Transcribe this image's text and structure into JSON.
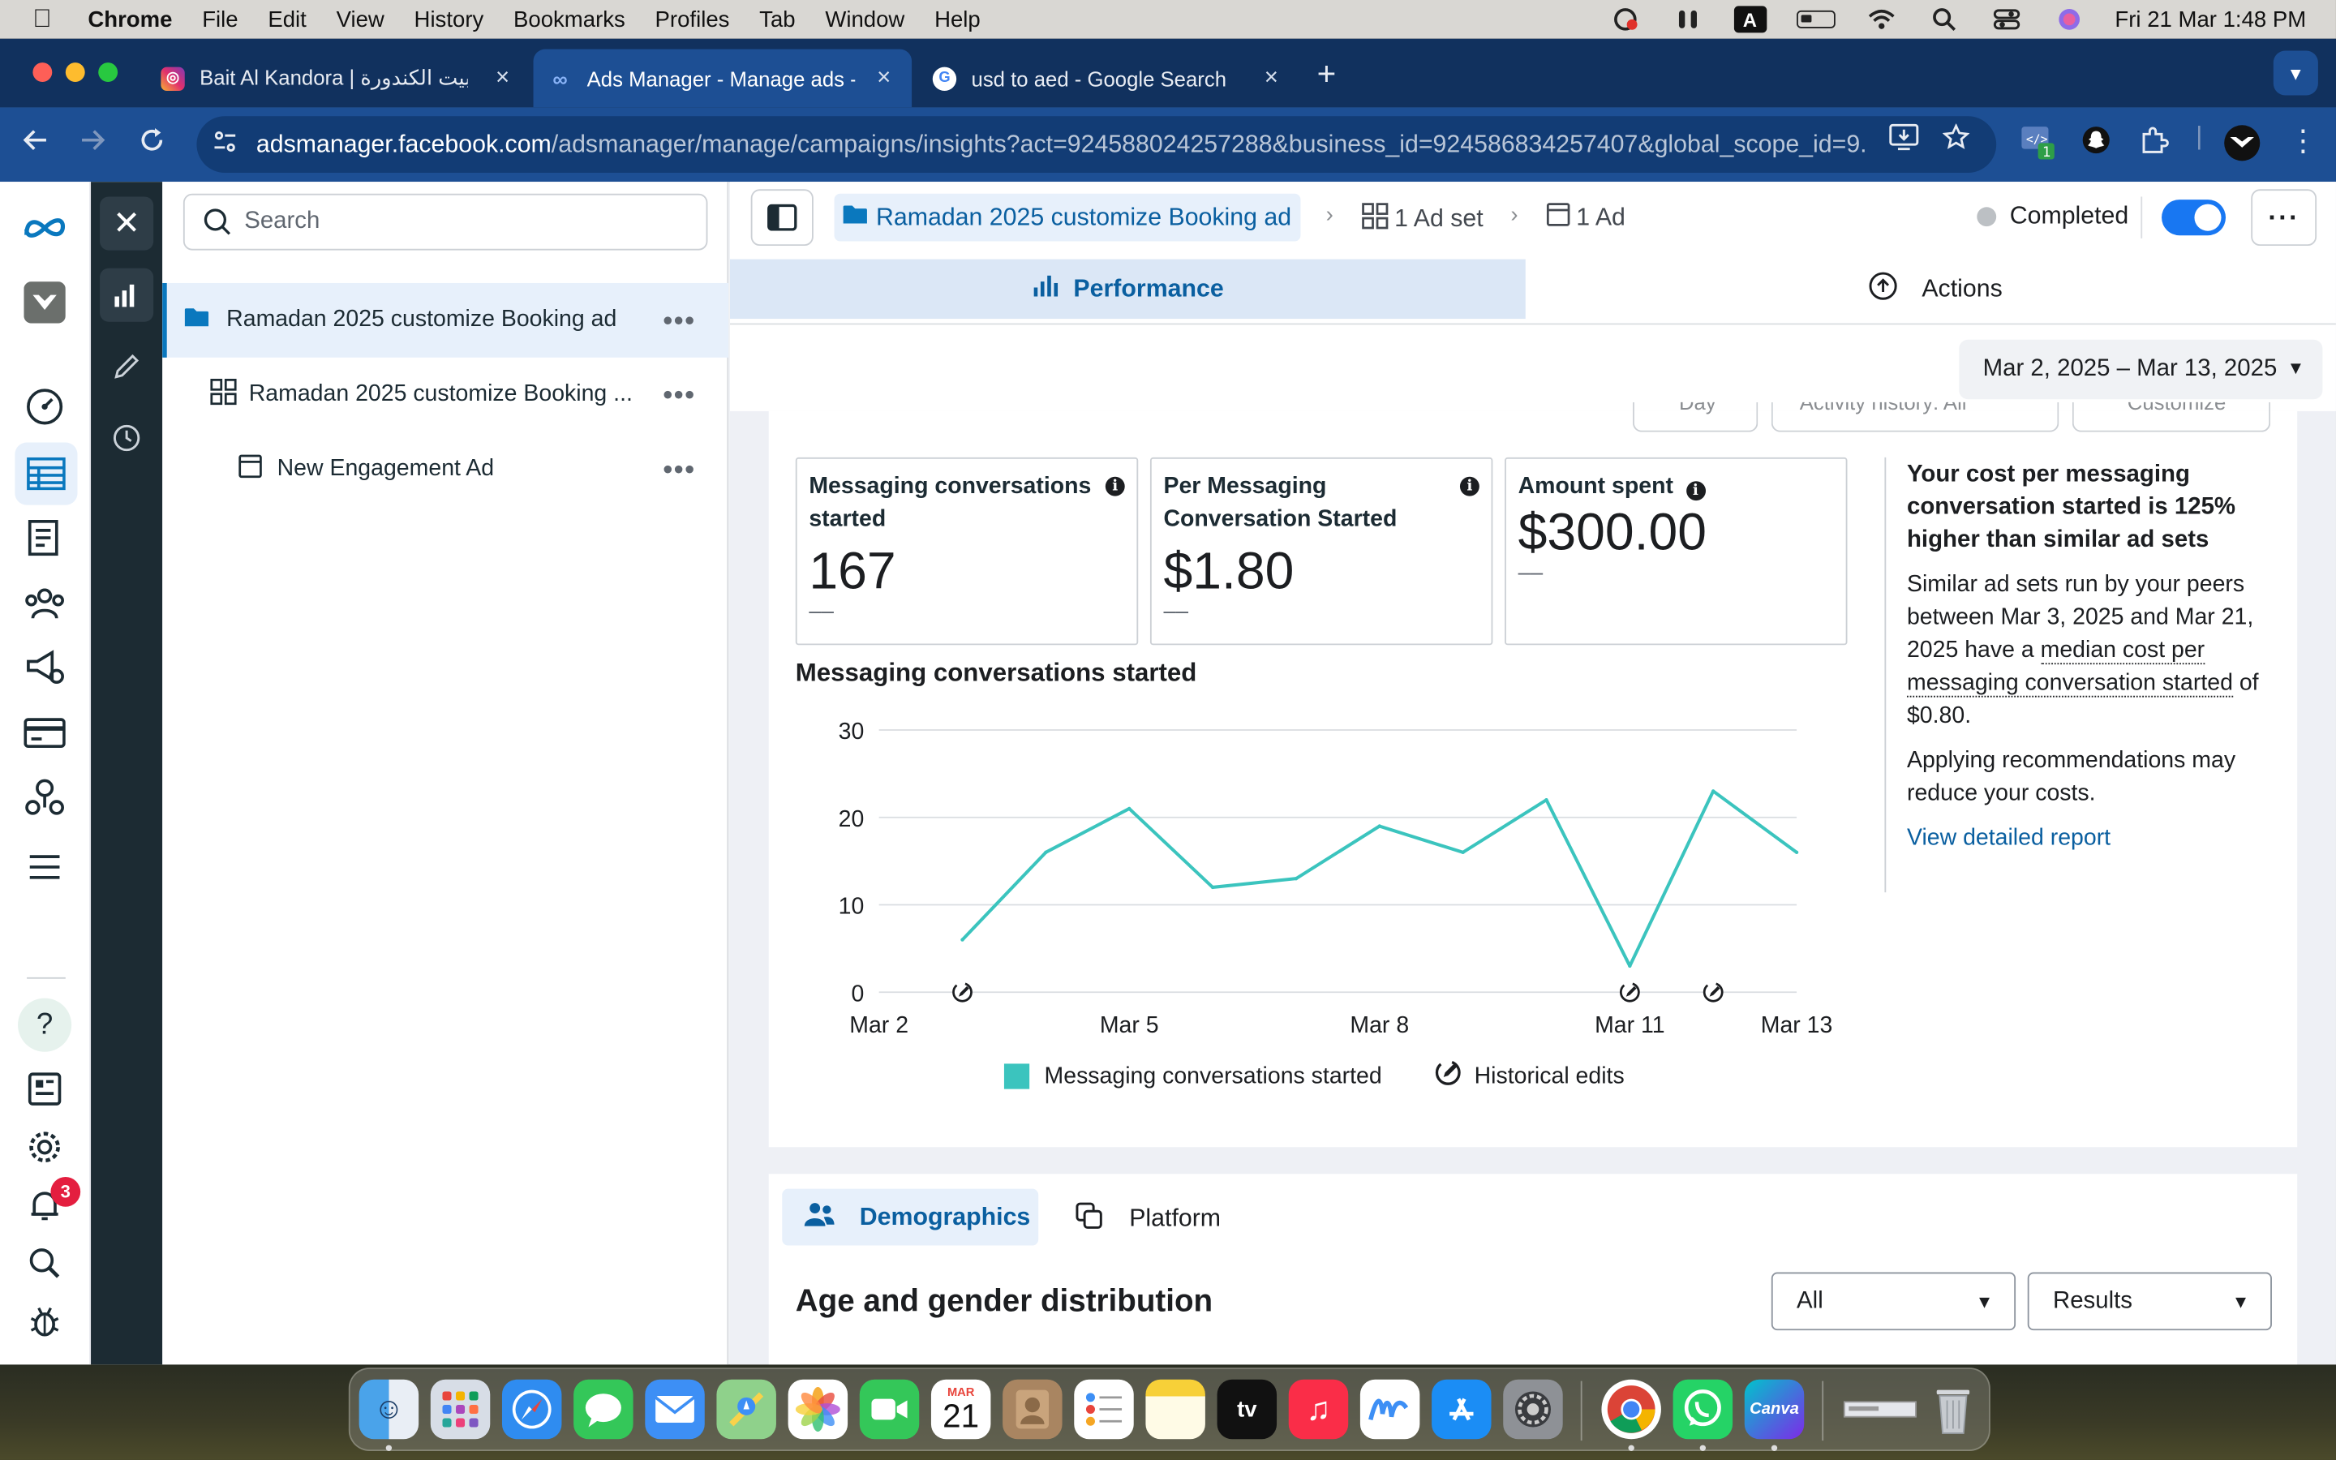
{
  "menubar": {
    "app": "Chrome",
    "items": [
      "File",
      "Edit",
      "View",
      "History",
      "Bookmarks",
      "Profiles",
      "Tab",
      "Window",
      "Help"
    ],
    "datetime": "Fri 21 Mar  1:48 PM",
    "a_label": "A"
  },
  "tabs": [
    {
      "title": "Bait Al Kandora | بيت الكندورة (…",
      "close": "×"
    },
    {
      "title": "Ads Manager - Manage ads -",
      "close": "×"
    },
    {
      "title": "usd to aed - Google Search",
      "close": "×"
    }
  ],
  "url": {
    "host": "adsmanager.facebook.com",
    "path": "/adsmanager/manage/campaigns/insights?act=924588024257288&business_id=924586834257407&global_scope_id=9..."
  },
  "tree": {
    "search_placeholder": "Search",
    "rows": [
      {
        "label": "Ramadan 2025 customize Booking ad"
      },
      {
        "label": "Ramadan 2025 customize Booking ..."
      },
      {
        "label": "New Engagement Ad"
      }
    ],
    "more": "•••"
  },
  "breadcrumb": {
    "campaign": "Ramadan 2025 customize Booking ad",
    "adset": "1 Ad set",
    "ad": "1 Ad"
  },
  "status": "Completed",
  "view_tabs": {
    "performance": "Performance",
    "actions": "Actions"
  },
  "date_range": "Mar 2, 2025 – Mar 13, 2025",
  "ghost_buttons": [
    "Day",
    "Activity history: All",
    "Customize"
  ],
  "metrics": [
    {
      "label": "Messaging conversations started",
      "value": "167",
      "compare": "––"
    },
    {
      "label": "Per Messaging Conversation Started",
      "value": "$1.80",
      "compare": "––"
    },
    {
      "label": "Amount spent",
      "value": "$300.00",
      "compare": "––"
    }
  ],
  "chart_title": "Messaging conversations started",
  "chart_data": {
    "type": "line",
    "title": "Messaging conversations started",
    "xlabel": "",
    "ylabel": "",
    "x": [
      "Mar 2",
      "Mar 3",
      "Mar 4",
      "Mar 5",
      "Mar 6",
      "Mar 7",
      "Mar 8",
      "Mar 9",
      "Mar 10",
      "Mar 11",
      "Mar 12",
      "Mar 13"
    ],
    "x_tick_labels": [
      "Mar 2",
      "Mar 5",
      "Mar 8",
      "Mar 11",
      "Mar 13"
    ],
    "series": [
      {
        "name": "Messaging conversations started",
        "color": "#3bc4be",
        "values": [
          6,
          16,
          21,
          12,
          13,
          19,
          16,
          22,
          3,
          23,
          16
        ]
      }
    ],
    "series_x_start": "Mar 3",
    "y_ticks": [
      0,
      10,
      20,
      30
    ],
    "ylim": [
      0,
      30
    ],
    "historical_edits_at": [
      "Mar 3",
      "Mar 11",
      "Mar 12"
    ],
    "grid": true,
    "legend_position": "bottom"
  },
  "legend": {
    "series": "Messaging conversations started",
    "edits": "Historical edits"
  },
  "insight": {
    "heading": "Your cost per messaging conversation started is 125% higher than similar ad sets",
    "body_pre": "Similar ad sets run by your peers between Mar 3, 2025 and Mar 21, 2025 have a",
    "body_term": "median cost per messaging conversation started",
    "body_post": "of $0.80.",
    "tip": "Applying recommendations may reduce your costs.",
    "link": "View detailed report"
  },
  "breakdown": {
    "tab_demographics": "Demographics",
    "tab_platform": "Platform",
    "heading": "Age and gender distribution",
    "filter_value": "All",
    "metric_value": "Results"
  },
  "notifications_count": "3",
  "dock_calendar": {
    "month": "MAR",
    "day": "21"
  },
  "dock_labels": {
    "tv": "tv",
    "canva": "Canva"
  },
  "colors": {
    "accent": "#0a5fa0",
    "series": "#3bc4be",
    "tabstrip": "#11315e",
    "toolbar": "#1d4f94"
  }
}
